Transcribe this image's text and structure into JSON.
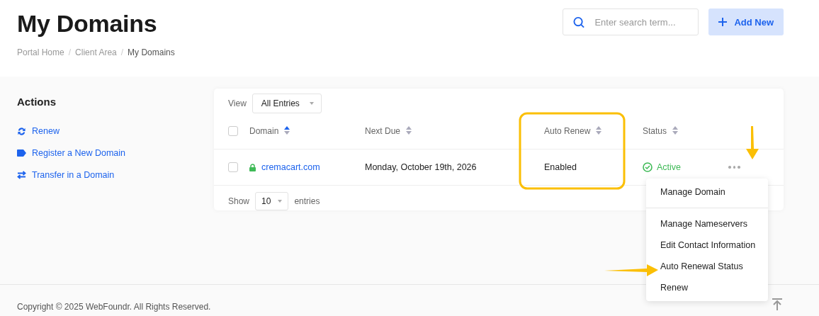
{
  "header": {
    "title": "My Domains",
    "breadcrumb": [
      {
        "label": "Portal Home",
        "current": false
      },
      {
        "label": "Client Area",
        "current": false
      },
      {
        "label": "My Domains",
        "current": true
      }
    ],
    "breadcrumb_separator": "/",
    "search": {
      "placeholder": "Enter search term..."
    },
    "add_button": {
      "label": "Add New"
    }
  },
  "sidebar": {
    "title": "Actions",
    "items": [
      {
        "label": "Renew",
        "kind": "renew"
      },
      {
        "label": "Register a New Domain",
        "kind": "register"
      },
      {
        "label": "Transfer in a Domain",
        "kind": "transfer"
      }
    ]
  },
  "table": {
    "view_label": "View",
    "view_filter": "All Entries",
    "select_all_checked": false,
    "columns": [
      {
        "label": "Domain",
        "sorted": true
      },
      {
        "label": "Next Due",
        "sorted": false
      },
      {
        "label": "Auto Renew",
        "sorted": false
      },
      {
        "label": "Status",
        "sorted": false
      }
    ],
    "rows": [
      {
        "checked": false,
        "domain": "cremacart.com",
        "next_due": "Monday, October 19th, 2026",
        "auto_renew": "Enabled",
        "status": "Active"
      }
    ],
    "show_label": "Show",
    "page_size": "10",
    "entries_label": "entries"
  },
  "row_menu": {
    "groups": [
      {
        "items": [
          "Manage Domain"
        ]
      },
      {
        "items": [
          "Manage Nameservers",
          "Edit Contact Information",
          "Auto Renewal Status",
          "Renew"
        ]
      }
    ]
  },
  "footer": {
    "copyright": "Copyright © 2025 WebFoundr. All Rights Reserved."
  }
}
